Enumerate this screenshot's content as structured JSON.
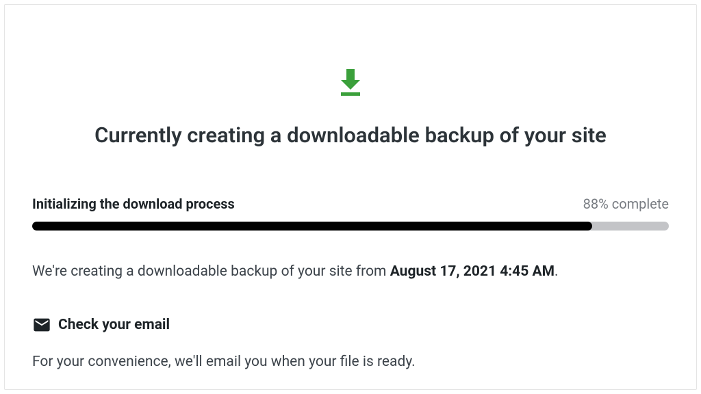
{
  "title": "Currently creating a downloadable backup of your site",
  "progress": {
    "label": "Initializing the download process",
    "percent_text": "88% complete",
    "percent_value": 88
  },
  "description": {
    "prefix": "We're creating a downloadable backup of your site from ",
    "timestamp": "August 17, 2021 4:45 AM",
    "suffix": "."
  },
  "email": {
    "heading": "Check your email",
    "note": "For your convenience, we'll email you when your file is ready."
  }
}
